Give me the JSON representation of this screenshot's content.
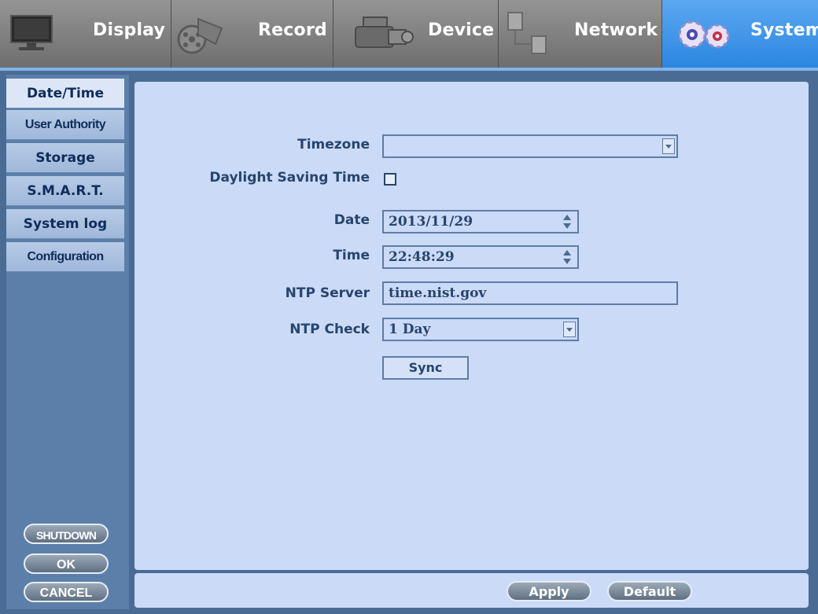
{
  "tabs": [
    {
      "label": "Display",
      "icon": "monitor-icon",
      "active": false
    },
    {
      "label": "Record",
      "icon": "film-reel-icon",
      "active": false
    },
    {
      "label": "Device",
      "icon": "camcorder-icon",
      "active": false
    },
    {
      "label": "Network",
      "icon": "network-icon",
      "active": false
    },
    {
      "label": "System",
      "icon": "gears-icon",
      "active": true
    }
  ],
  "sidebar": {
    "items": [
      {
        "label": "Date/Time",
        "active": true
      },
      {
        "label": "User Authority",
        "active": false
      },
      {
        "label": "Storage",
        "active": false
      },
      {
        "label": "S.M.A.R.T.",
        "active": false
      },
      {
        "label": "System log",
        "active": false
      },
      {
        "label": "Configuration",
        "active": false
      }
    ],
    "shutdown_label": "SHUTDOWN",
    "ok_label": "OK",
    "cancel_label": "CANCEL"
  },
  "form": {
    "timezone_label": "Timezone",
    "timezone_value": "",
    "dst_label": "Daylight Saving Time",
    "dst_checked": false,
    "date_label": "Date",
    "date_value": "2013/11/29",
    "time_label": "Time",
    "time_value": "22:48:29",
    "ntp_server_label": "NTP Server",
    "ntp_server_value": "time.nist.gov",
    "ntp_check_label": "NTP Check",
    "ntp_check_value": "1 Day",
    "sync_label": "Sync"
  },
  "footer": {
    "apply_label": "Apply",
    "default_label": "Default"
  },
  "colors": {
    "active_tab": "#3a95e8",
    "panel_bg": "#cbdaf6",
    "label_text": "#27456e",
    "frame_bg": "#4a6b93"
  }
}
